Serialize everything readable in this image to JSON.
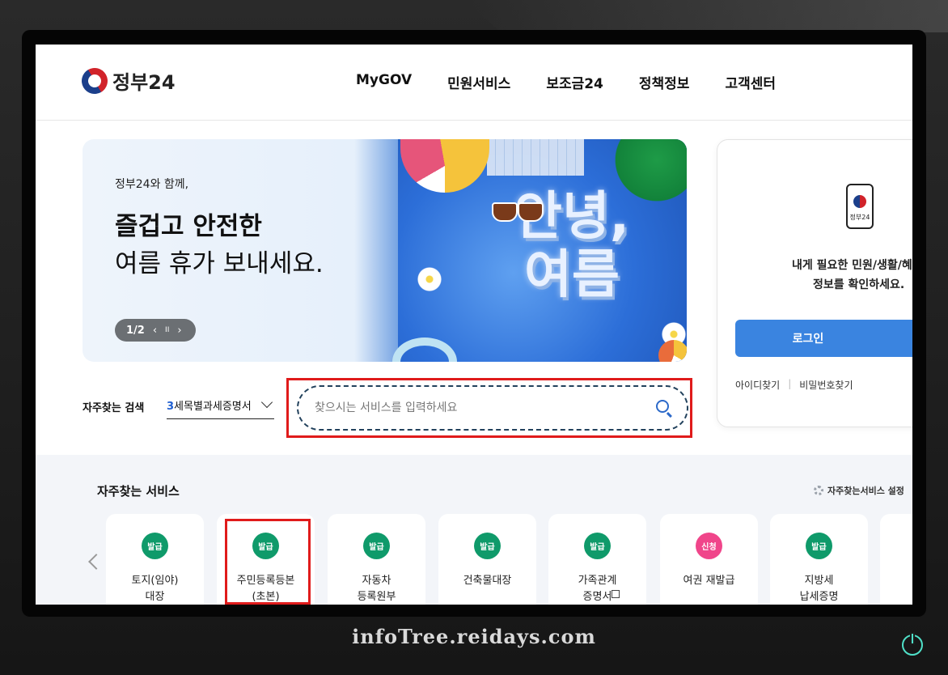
{
  "header": {
    "logo_text": "정부24",
    "nav": [
      "MyGOV",
      "민원서비스",
      "보조금24",
      "정책정보",
      "고객센터"
    ]
  },
  "banner": {
    "subtitle": "정부24와 함께,",
    "title_line1": "즐겁고 안전한",
    "title_line2": "여름 휴가 보내세요.",
    "image_text": "안녕, 여름",
    "pager": {
      "index": "1/2",
      "prev": "‹",
      "pause": "II",
      "next": "›"
    }
  },
  "login": {
    "phone_label": "정부24",
    "message_line1": "내게 필요한 민원/생활/혜",
    "message_line2": "정보를 확인하세요.",
    "login_button": "로그인",
    "find_id": "아이디찾기",
    "find_password": "비밀번호찾기"
  },
  "search": {
    "frequent_label": "자주찾는 검색",
    "frequent_selected_num": "3",
    "frequent_selected_text": "세목별과세증명서",
    "placeholder": "찾으시는 서비스를 입력하세요"
  },
  "services": {
    "title": "자주찾는 서비스",
    "setting": "자주찾는서비스 설정",
    "items": [
      {
        "badge": "발급",
        "label": "토지(임야)\n대장"
      },
      {
        "badge": "발급",
        "label": "주민등록등본\n(초본)"
      },
      {
        "badge": "발급",
        "label": "자동차\n등록원부"
      },
      {
        "badge": "발급",
        "label": "건축물대장"
      },
      {
        "badge": "발급",
        "label": "가족관계\n증명서"
      },
      {
        "badge": "신청",
        "label": "여권 재발급"
      },
      {
        "badge": "발급",
        "label": "지방세\n납세증명"
      }
    ]
  },
  "footer_brand": "infoTree.reidays.com",
  "colors": {
    "accent": "#3a84e0",
    "badge_green": "#0f9a6a",
    "badge_pink": "#f0458a",
    "highlight": "#e01b1b"
  }
}
